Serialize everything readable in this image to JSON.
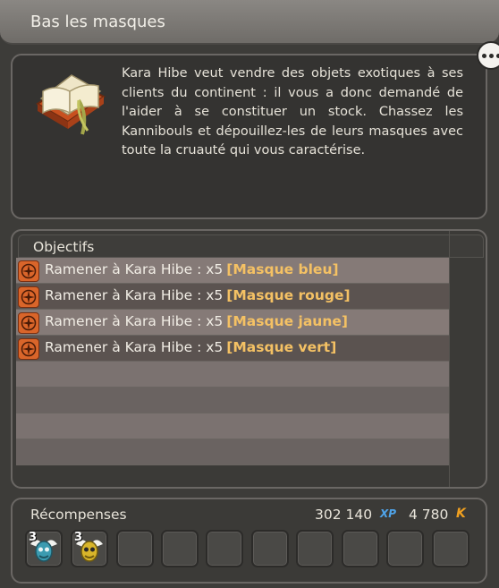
{
  "window": {
    "title": "Bas les masques"
  },
  "quest": {
    "description": "Kara Hibe veut vendre des objets exotiques à ses clients du continent : il vous a donc demandé de l'aider à se constituer un stock. Chassez les Kannibouls et dépouillez-les de leurs masques avec toute la cruauté qui vous caractérise."
  },
  "objectives": {
    "header": "Objectifs",
    "items": [
      {
        "text": "Ramener à Kara Hibe : x5",
        "item": "[Masque bleu]"
      },
      {
        "text": "Ramener à Kara Hibe : x5",
        "item": "[Masque rouge]"
      },
      {
        "text": "Ramener à Kara Hibe : x5",
        "item": "[Masque jaune]"
      },
      {
        "text": "Ramener à Kara Hibe : x5",
        "item": "[Masque vert]"
      }
    ]
  },
  "rewards": {
    "label": "Récompenses",
    "xp": "302 140",
    "xp_icon": "XP",
    "kamas": "4 780",
    "kamas_icon": "K",
    "items": [
      {
        "qty": "3",
        "icon": "winged-mask-blue-icon"
      },
      {
        "qty": "3",
        "icon": "winged-mask-yellow-icon"
      }
    ]
  },
  "colors": {
    "item_highlight": "#f4c164",
    "objective_icon": "#d9652a"
  }
}
